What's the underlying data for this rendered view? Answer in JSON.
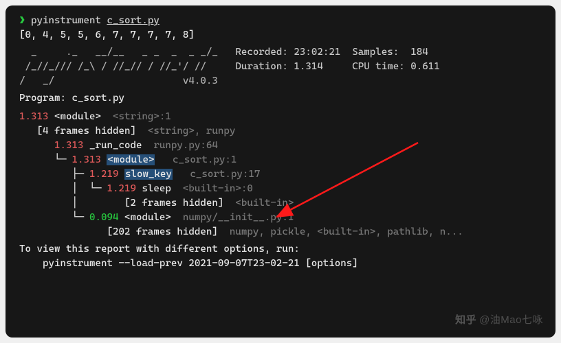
{
  "prompt": {
    "arrow": "❯",
    "command": "pyinstrument",
    "arg": "c_sort.py"
  },
  "output_list": "[0, 4, 5, 5, 6, 7, 7, 7, 7, 8]",
  "ascii": {
    "l1": "  _     ._   __/__   _ _  _  _ _/_",
    "l2": " /_//_/// /_\\ / //_// / //_'/ //",
    "l3": "/   _/                      v4.0.3"
  },
  "version": "v4.0.3",
  "stats": {
    "recorded_lbl": "Recorded:",
    "recorded": "23:02:21",
    "samples_lbl": "Samples:",
    "samples": "184",
    "duration_lbl": "Duration:",
    "duration": "1.314",
    "cpu_lbl": "CPU time:",
    "cpu": "0.611"
  },
  "program_lbl": "Program:",
  "program": "c_sort.py",
  "tree": {
    "t0_time": "1.313",
    "t0_name": "<module>",
    "t0_loc": "<string>:1",
    "hidden0": "[4 frames hidden]  ",
    "hidden0_loc": "<string>, runpy",
    "t1_time": "1.313",
    "t1_name": "_run_code",
    "t1_loc": "runpy.py:64",
    "t2_prefix": "└─ ",
    "t2_time": "1.313",
    "t2_name": "<module>",
    "t2_loc": "c_sort.py:1",
    "t3_prefix": "   ├─ ",
    "t3_time": "1.219",
    "t3_name": "slow_key",
    "t3_loc": "c_sort.py:17",
    "t4_prefix": "   │  └─ ",
    "t4_time": "1.219",
    "t4_name": "sleep",
    "t4_loc": "<built-in>:0",
    "hidden4_prefix": "   │        ",
    "hidden4": "[2 frames hidden]  ",
    "hidden4_loc": "<built-in>",
    "t5_prefix": "   └─ ",
    "t5_time": "0.094",
    "t5_name": "<module>",
    "t5_loc": "numpy/__init__.py:1",
    "hidden5_prefix": "         ",
    "hidden5": "[202 frames hidden]  ",
    "hidden5_loc": "numpy, pickle, <built-in>, pathlib, n..."
  },
  "footer": {
    "line1": "To view this report with different options, run:",
    "line2": "    pyinstrument --load-prev 2021-09-07T23-02-21 [options]"
  },
  "watermark": {
    "logo": "知乎",
    "text": "@油Mao七咏"
  }
}
